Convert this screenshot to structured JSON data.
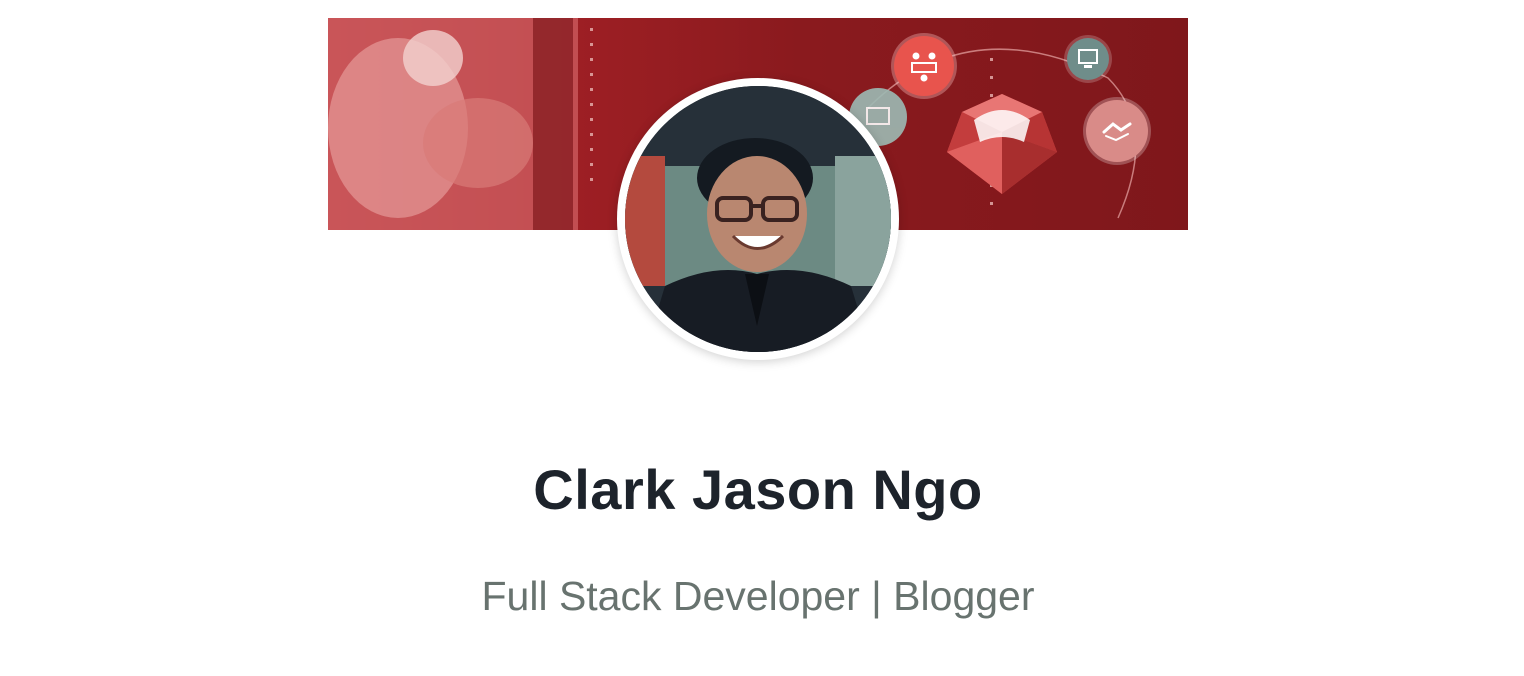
{
  "profile": {
    "name": "Clark Jason Ngo",
    "headline": "Full Stack Developer | Blogger"
  },
  "cover": {
    "icons": [
      "team-meeting-icon",
      "computer-icon",
      "chat-icon",
      "handshake-icon",
      "ruby-gem-icon"
    ]
  },
  "colors": {
    "banner_red": "#8a1a1e",
    "banner_light": "#c84b4f",
    "name_text": "#1d232b",
    "headline_text": "#68736f"
  }
}
